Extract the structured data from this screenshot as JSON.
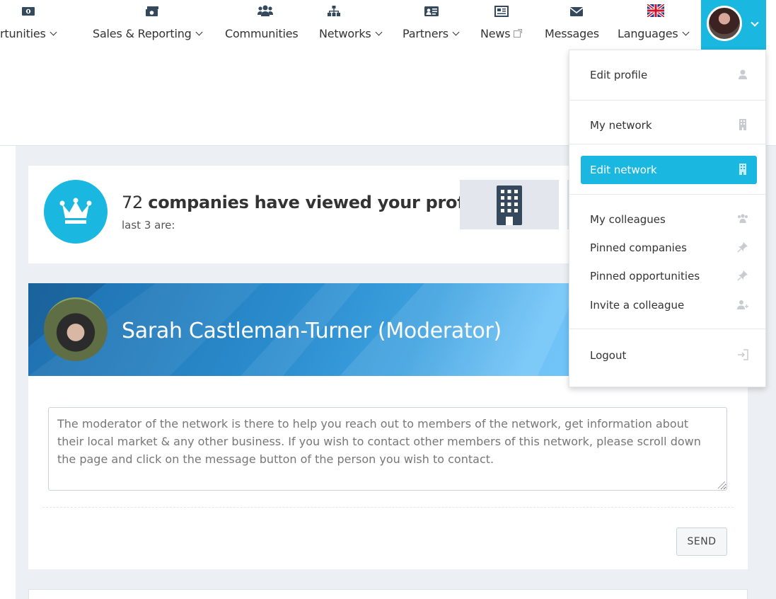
{
  "nav": {
    "items": [
      {
        "label": "rtunities",
        "icon": "money-icon",
        "dropdown": true
      },
      {
        "label": "Sales & Reporting",
        "icon": "cash-icon",
        "dropdown": true
      },
      {
        "label": "Communities",
        "icon": "users-icon",
        "dropdown": false
      },
      {
        "label": "Networks",
        "icon": "sitemap-icon",
        "dropdown": true
      },
      {
        "label": "Partners",
        "icon": "address-card-icon",
        "dropdown": true
      },
      {
        "label": "News",
        "icon": "newspaper-icon",
        "external": true
      },
      {
        "label": "Messages",
        "icon": "envelope-icon",
        "dropdown": false
      },
      {
        "label": "Languages",
        "icon": "uk-flag-icon",
        "dropdown": true
      }
    ]
  },
  "views": {
    "count": "72",
    "text": "companies have viewed your profile",
    "sub": "last 3 are:"
  },
  "moderator": {
    "name": "Sarah Castleman-Turner (Moderator)",
    "message": "The moderator of the network is there to help you reach out to members of the network, get information about their local market & any other business.  If you wish to contact other members of this network, please scroll down the page and click on the message button of the person you wish to contact.",
    "send_label": "SEND"
  },
  "menu": {
    "edit_profile": "Edit profile",
    "my_network": "My network",
    "edit_network": "Edit network",
    "my_colleagues": "My colleagues",
    "pinned_companies": "Pinned companies",
    "pinned_opportunities": "Pinned opportunities",
    "invite_colleague": "Invite a colleague",
    "logout": "Logout"
  },
  "colors": {
    "accent": "#1ab7e0",
    "icon_gray": "#c8ccd0",
    "dark_icon": "#34495e"
  }
}
